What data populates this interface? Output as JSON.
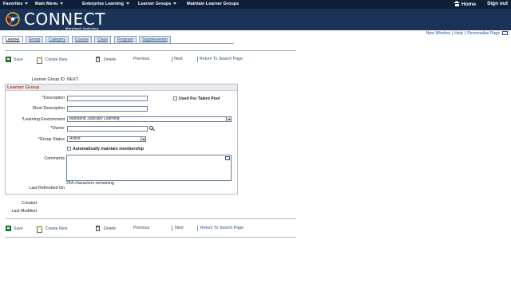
{
  "topnav": {
    "favorites": "Favorites",
    "main_menu": "Main Menu",
    "enterprise_learning": "Enterprise Learning",
    "learner_groups": "Learner Groups",
    "current_page": "Maintain Learner Groups",
    "home": "Home",
    "sign_out": "Sign out"
  },
  "banner": {
    "brand": "CONNECT",
    "subtitle": "Maryland Judiciary"
  },
  "utility": {
    "new_window": "New Window",
    "help": "Help",
    "personalize": "Personalize Page"
  },
  "tabs": [
    "Learner",
    "Group",
    "Category",
    "Course",
    "Class",
    "Program",
    "Supplemental"
  ],
  "toolbar": {
    "save": "Save",
    "create_new": "Create New",
    "delete": "Delete",
    "previous": "Previous",
    "next": "Next",
    "return": "Return To Search Page"
  },
  "form": {
    "learner_group_id_label": "Learner Group ID",
    "learner_group_id_value": "NEXT",
    "section_title": "Learner Group",
    "description_label": "*Description",
    "description_value": "",
    "used_for_talent_pool": "Used For Talent Pool",
    "short_description_label": "Short Description",
    "short_description_value": "",
    "learning_environment_label": "*Learning Environment",
    "learning_environment_value": "Maryland Judiciary Learning",
    "owner_label": "*Owner",
    "owner_value": "",
    "group_status_label": "*Group Status",
    "group_status_value": "Active",
    "auto_maintain": "Automatically maintain membership",
    "comments_label": "Comments",
    "chars_remaining": "254 characters remaining",
    "last_refreshed_label": "Last Refreshed On",
    "created_label": "Created",
    "last_modified_label": "Last Modified"
  }
}
